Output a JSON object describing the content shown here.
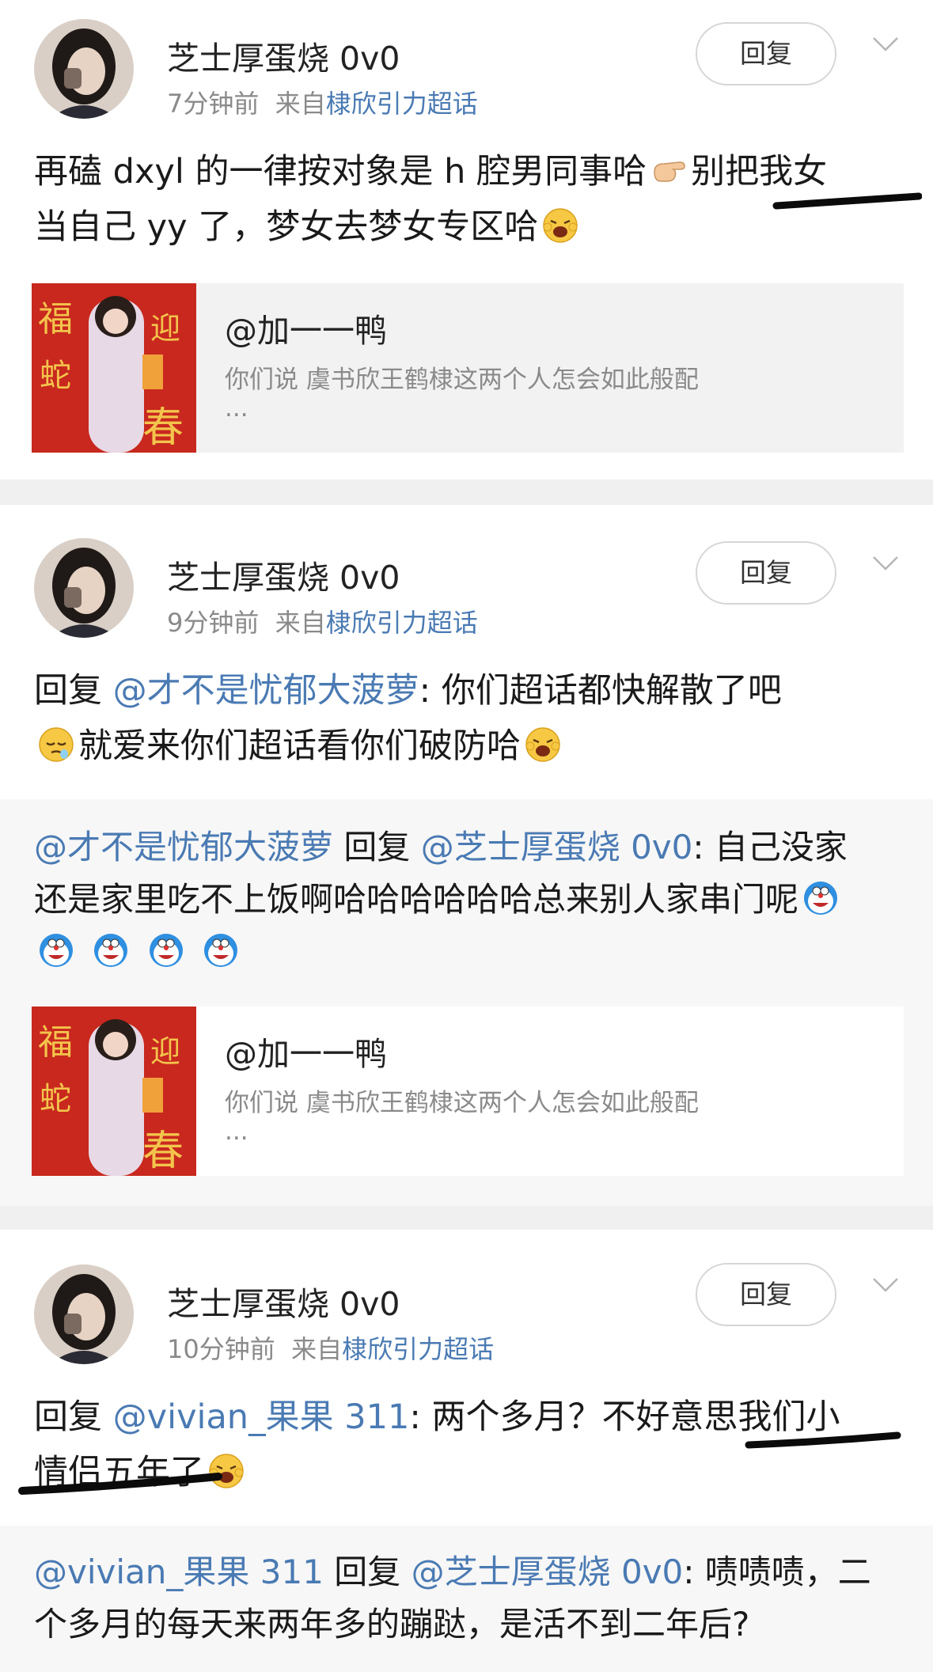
{
  "comments": [
    {
      "user": "芝士厚蛋烧 0v0",
      "time": "7分钟前",
      "from_label": "来自",
      "source": "棣欣引力超话",
      "reply_label": "回复",
      "text_line1": "再磕 dxyl 的一律按对象是 h 腔男同事哈",
      "text_line1b": "别把我女",
      "text_line2": "当自己 yy 了，梦女去梦女专区哈",
      "share": {
        "title": "@加一一鸭",
        "desc": "你们说 虞书欣王鹤棣这两个人怎会如此般配",
        "more": "..."
      }
    },
    {
      "user": "芝士厚蛋烧 0v0",
      "time": "9分钟前",
      "from_label": "来自",
      "source": "棣欣引力超话",
      "reply_label": "回复",
      "reply_prefix": "回复 ",
      "mention": "@才不是忧郁大菠萝",
      "text_line1": ": 你们超话都快解散了吧",
      "text_line2": "就爱来你们超话看你们破防哈",
      "sub": {
        "mention1": "@才不是忧郁大菠萝",
        "reply_word": " 回复 ",
        "mention2": "@芝士厚蛋烧 0v0",
        "text_line1": ": 自己没家",
        "text_line2": "还是家里吃不上饭啊哈哈哈哈哈哈总来别人家串门呢"
      },
      "share": {
        "title": "@加一一鸭",
        "desc": "你们说 虞书欣王鹤棣这两个人怎会如此般配",
        "more": "..."
      }
    },
    {
      "user": "芝士厚蛋烧 0v0",
      "time": "10分钟前",
      "from_label": "来自",
      "source": "棣欣引力超话",
      "reply_label": "回复",
      "reply_prefix": "回复 ",
      "mention": "@vivian_果果 311",
      "text_line1": ": 两个多月？不好意思我们小",
      "text_line2": "情侣五年了",
      "sub": {
        "mention1": "@vivian_果果 311",
        "reply_word": " 回复 ",
        "mention2": "@芝士厚蛋烧 0v0",
        "text_line1": ": 啧啧啧，二",
        "text_line2": "个多月的每天来两年多的蹦跶，是活不到二年后?"
      }
    }
  ],
  "colors": {
    "link": "#4a7ab3",
    "meta": "#8a8a8a",
    "separator": "#f0f0f0",
    "sub_bg": "#f7f7f7"
  }
}
